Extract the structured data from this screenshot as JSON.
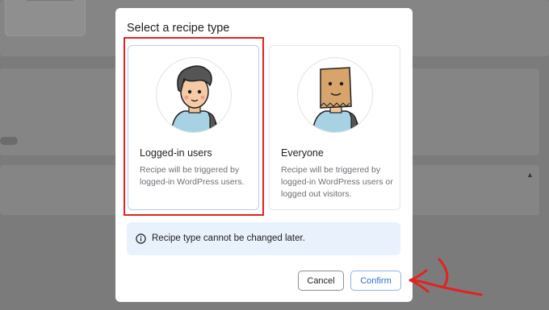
{
  "modal": {
    "title": "Select a recipe type",
    "options": [
      {
        "label": "Logged-in users",
        "description": "Recipe will be triggered by logged-in WordPress users.",
        "avatar_icon": "user-avatar-icon",
        "selected": true
      },
      {
        "label": "Everyone",
        "description": "Recipe will be triggered by logged-in WordPress users or logged out visitors.",
        "avatar_icon": "paper-bag-avatar-icon",
        "selected": false
      }
    ],
    "notice": {
      "icon": "info-icon",
      "text": "Recipe type cannot be changed later."
    },
    "buttons": {
      "cancel": "Cancel",
      "confirm": "Confirm"
    }
  },
  "colors": {
    "overlay": "#7b7b7b",
    "accent": "#2a6fd1",
    "notice_bg": "#e9f1fc",
    "highlight": "#e0241f"
  }
}
